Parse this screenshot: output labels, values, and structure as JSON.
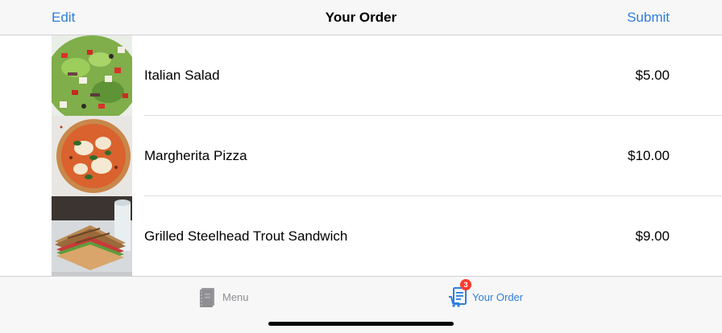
{
  "navbar": {
    "left_label": "Edit",
    "title": "Your Order",
    "right_label": "Submit"
  },
  "order_items": [
    {
      "name": "Italian Salad",
      "price": "$5.00",
      "image": "italian-salad-photo"
    },
    {
      "name": "Margherita Pizza",
      "price": "$10.00",
      "image": "margherita-pizza-photo"
    },
    {
      "name": "Grilled Steelhead Trout Sandwich",
      "price": "$9.00",
      "image": "trout-sandwich-photo"
    }
  ],
  "tabbar": {
    "tabs": [
      {
        "label": "Menu",
        "icon": "menu-book-icon",
        "selected": false
      },
      {
        "label": "Your Order",
        "icon": "order-cart-icon",
        "selected": true,
        "badge": "3"
      }
    ]
  },
  "colors": {
    "accent": "#2f7ddb",
    "badge": "#ff3b30",
    "inactive_tab": "#8e8e93"
  }
}
